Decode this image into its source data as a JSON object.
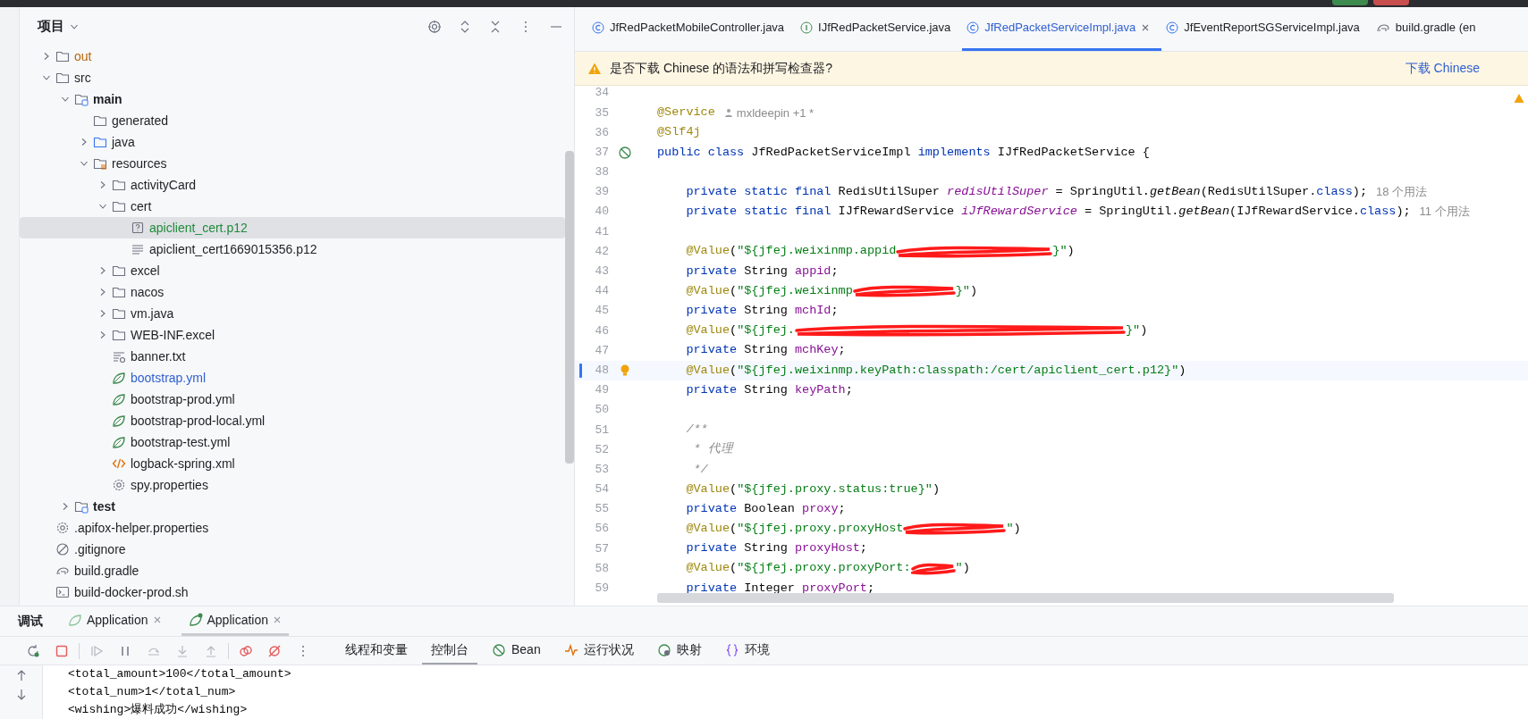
{
  "project_panel": {
    "title": "项目",
    "tree": [
      {
        "name": "out",
        "kind": "folder",
        "color": "#b8650b",
        "expanded": false,
        "selected": false
      },
      {
        "name": "src",
        "kind": "folder",
        "expanded": true,
        "selected": false,
        "children": [
          {
            "name": "main",
            "kind": "module",
            "expanded": true,
            "selected": false,
            "children": [
              {
                "name": "generated",
                "kind": "folder",
                "selected": false
              },
              {
                "name": "java",
                "kind": "source",
                "expanded": false,
                "selected": false
              },
              {
                "name": "resources",
                "kind": "resources",
                "expanded": true,
                "selected": false,
                "children": [
                  {
                    "name": "activityCard",
                    "kind": "folder",
                    "expanded": false,
                    "selected": false
                  },
                  {
                    "name": "cert",
                    "kind": "folder",
                    "expanded": true,
                    "selected": false,
                    "children": [
                      {
                        "name": "apiclient_cert.p12",
                        "kind": "unknown",
                        "color": "#1f8a3a",
                        "selected": true
                      },
                      {
                        "name": "apiclient_cert1669015356.p12",
                        "kind": "text",
                        "selected": false
                      }
                    ]
                  },
                  {
                    "name": "excel",
                    "kind": "folder",
                    "expanded": false,
                    "selected": false
                  },
                  {
                    "name": "nacos",
                    "kind": "folder",
                    "expanded": false,
                    "selected": false
                  },
                  {
                    "name": "vm.java",
                    "kind": "folder",
                    "expanded": false,
                    "selected": false
                  },
                  {
                    "name": "WEB-INF.excel",
                    "kind": "folder",
                    "expanded": false,
                    "selected": false
                  },
                  {
                    "name": "banner.txt",
                    "kind": "textlock",
                    "selected": false
                  },
                  {
                    "name": "bootstrap.yml",
                    "kind": "spring",
                    "color": "#2f5fd0",
                    "selected": false
                  },
                  {
                    "name": "bootstrap-prod.yml",
                    "kind": "spring",
                    "selected": false
                  },
                  {
                    "name": "bootstrap-prod-local.yml",
                    "kind": "spring",
                    "selected": false
                  },
                  {
                    "name": "bootstrap-test.yml",
                    "kind": "spring",
                    "selected": false
                  },
                  {
                    "name": "logback-spring.xml",
                    "kind": "xml",
                    "selected": false
                  },
                  {
                    "name": "spy.properties",
                    "kind": "gear",
                    "selected": false
                  }
                ]
              }
            ]
          },
          {
            "name": "test",
            "kind": "module",
            "expanded": false,
            "selected": false
          }
        ]
      },
      {
        "name": ".apifox-helper.properties",
        "kind": "gear",
        "selected": false
      },
      {
        "name": ".gitignore",
        "kind": "ignore",
        "selected": false
      },
      {
        "name": "build.gradle",
        "kind": "gradle",
        "selected": false
      },
      {
        "name": "build-docker-prod.sh",
        "kind": "shell",
        "selected": false
      }
    ]
  },
  "editor": {
    "tabs": [
      {
        "label": "JfRedPacketMobileController.java",
        "kind": "class",
        "selected": false
      },
      {
        "label": "IJfRedPacketService.java",
        "kind": "interface",
        "selected": false
      },
      {
        "label": "JfRedPacketServiceImpl.java",
        "kind": "class",
        "selected": true
      },
      {
        "label": "JfEventReportSGServiceImpl.java",
        "kind": "class",
        "selected": false
      },
      {
        "label": "build.gradle (en",
        "kind": "gradle",
        "selected": false
      }
    ],
    "notification": {
      "message": "是否下载 Chinese 的语法和拼写检查器?",
      "action": "下载 Chinese"
    },
    "lines": [
      {
        "number": "34",
        "kind": "plain",
        "current": false
      },
      {
        "number": "35",
        "kind": "plain",
        "current": false,
        "tokens": [
          {
            "kind": "annotation",
            "text": "@Service"
          }
        ],
        "hint": {
          "kind": "author",
          "text": "mxldeepin +1 *"
        }
      },
      {
        "number": "36",
        "kind": "plain",
        "current": false,
        "tokens": [
          {
            "kind": "annotation",
            "text": "@Slf4j"
          }
        ]
      },
      {
        "number": "37",
        "kind": "bean",
        "current": false,
        "tokens": [
          {
            "kind": "keyword",
            "text": "public class "
          },
          {
            "kind": "plain",
            "text": "JfRedPacketServiceImpl "
          },
          {
            "kind": "keyword",
            "text": "implements "
          },
          {
            "kind": "plain",
            "text": "IJfRedPacketService {"
          }
        ]
      },
      {
        "number": "38",
        "kind": "plain",
        "current": false
      },
      {
        "number": "39",
        "kind": "plain",
        "current": false,
        "tokens": [
          {
            "kind": "keyword",
            "text": "    private static final "
          },
          {
            "kind": "plain",
            "text": "RedisUtilSuper "
          },
          {
            "kind": "static",
            "text": "redisUtilSuper"
          },
          {
            "kind": "plain",
            "text": " = SpringUtil."
          },
          {
            "kind": "method",
            "text": "getBean"
          },
          {
            "kind": "plain",
            "text": "(RedisUtilSuper."
          },
          {
            "kind": "keyword",
            "text": "class"
          },
          {
            "kind": "plain",
            "text": ");"
          }
        ],
        "hint": {
          "kind": "usages",
          "text": "18 个用法"
        }
      },
      {
        "number": "40",
        "kind": "plain",
        "current": false,
        "tokens": [
          {
            "kind": "keyword",
            "text": "    private static final "
          },
          {
            "kind": "plain",
            "text": "IJfRewardService "
          },
          {
            "kind": "static",
            "text": "iJfRewardService"
          },
          {
            "kind": "plain",
            "text": " = SpringUtil."
          },
          {
            "kind": "method",
            "text": "getBean"
          },
          {
            "kind": "plain",
            "text": "(IJfRewardService."
          },
          {
            "kind": "keyword",
            "text": "class"
          },
          {
            "kind": "plain",
            "text": ");"
          }
        ],
        "hint": {
          "kind": "usages",
          "text": "11 个用法"
        }
      },
      {
        "number": "41",
        "kind": "plain",
        "current": false
      },
      {
        "number": "42",
        "kind": "plain",
        "current": false,
        "tokens": [
          {
            "kind": "annotation",
            "text": "    @Value"
          },
          {
            "kind": "plain",
            "text": "("
          },
          {
            "kind": "string",
            "text": "\"${jfej.weixinmp.appid"
          },
          {
            "kind": "redacted-long"
          },
          {
            "kind": "string",
            "text": "}\""
          },
          {
            "kind": "plain",
            "text": ")"
          }
        ]
      },
      {
        "number": "43",
        "kind": "plain",
        "current": false,
        "tokens": [
          {
            "kind": "keyword",
            "text": "    private "
          },
          {
            "kind": "plain",
            "text": "String "
          },
          {
            "kind": "field",
            "text": "appid"
          },
          {
            "kind": "plain",
            "text": ";"
          }
        ]
      },
      {
        "number": "44",
        "kind": "plain",
        "current": false,
        "tokens": [
          {
            "kind": "annotation",
            "text": "    @Value"
          },
          {
            "kind": "plain",
            "text": "("
          },
          {
            "kind": "string",
            "text": "\"${jfej.weixinmp"
          },
          {
            "kind": "redacted-medium"
          },
          {
            "kind": "string",
            "text": "}\""
          },
          {
            "kind": "plain",
            "text": ")"
          }
        ]
      },
      {
        "number": "45",
        "kind": "plain",
        "current": false,
        "tokens": [
          {
            "kind": "keyword",
            "text": "    private "
          },
          {
            "kind": "plain",
            "text": "String "
          },
          {
            "kind": "field",
            "text": "mchId"
          },
          {
            "kind": "plain",
            "text": ";"
          }
        ]
      },
      {
        "number": "46",
        "kind": "plain",
        "current": false,
        "tokens": [
          {
            "kind": "annotation",
            "text": "    @Value"
          },
          {
            "kind": "plain",
            "text": "("
          },
          {
            "kind": "string",
            "text": "\"${jfej."
          },
          {
            "kind": "redacted-xlong"
          },
          {
            "kind": "string",
            "text": "}\""
          },
          {
            "kind": "plain",
            "text": ")"
          }
        ]
      },
      {
        "number": "47",
        "kind": "plain",
        "current": false,
        "tokens": [
          {
            "kind": "keyword",
            "text": "    private "
          },
          {
            "kind": "plain",
            "text": "String "
          },
          {
            "kind": "field",
            "text": "mchKey"
          },
          {
            "kind": "plain",
            "text": ";"
          }
        ]
      },
      {
        "number": "48",
        "kind": "bulb",
        "current": true,
        "tokens": [
          {
            "kind": "annotation",
            "text": "    @Value"
          },
          {
            "kind": "plain",
            "text": "("
          },
          {
            "kind": "string",
            "text": "\"${jfej.weixinmp.keyPath:classpath:/cert/apiclient_cert.p12}\""
          },
          {
            "kind": "plain",
            "text": ")"
          }
        ]
      },
      {
        "number": "49",
        "kind": "plain",
        "current": false,
        "tokens": [
          {
            "kind": "keyword",
            "text": "    private "
          },
          {
            "kind": "plain",
            "text": "String "
          },
          {
            "kind": "field",
            "text": "keyPath"
          },
          {
            "kind": "plain",
            "text": ";"
          }
        ]
      },
      {
        "number": "50",
        "kind": "plain",
        "current": false
      },
      {
        "number": "51",
        "kind": "plain",
        "current": false,
        "tokens": [
          {
            "kind": "comment",
            "text": "    /**"
          }
        ]
      },
      {
        "number": "52",
        "kind": "plain",
        "current": false,
        "tokens": [
          {
            "kind": "comment",
            "text": "     * 代理"
          }
        ]
      },
      {
        "number": "53",
        "kind": "plain",
        "current": false,
        "tokens": [
          {
            "kind": "comment",
            "text": "     */"
          }
        ]
      },
      {
        "number": "54",
        "kind": "plain",
        "current": false,
        "tokens": [
          {
            "kind": "annotation",
            "text": "    @Value"
          },
          {
            "kind": "plain",
            "text": "("
          },
          {
            "kind": "string",
            "text": "\"${jfej.proxy.status:true}\""
          },
          {
            "kind": "plain",
            "text": ")"
          }
        ]
      },
      {
        "number": "55",
        "kind": "plain",
        "current": false,
        "tokens": [
          {
            "kind": "keyword",
            "text": "    private "
          },
          {
            "kind": "plain",
            "text": "Boolean "
          },
          {
            "kind": "field",
            "text": "proxy"
          },
          {
            "kind": "plain",
            "text": ";"
          }
        ]
      },
      {
        "number": "56",
        "kind": "plain",
        "current": false,
        "tokens": [
          {
            "kind": "annotation",
            "text": "    @Value"
          },
          {
            "kind": "plain",
            "text": "("
          },
          {
            "kind": "string",
            "text": "\"${jfej.proxy.proxyHost"
          },
          {
            "kind": "redacted-medium"
          },
          {
            "kind": "string",
            "text": "\""
          },
          {
            "kind": "plain",
            "text": ")"
          }
        ]
      },
      {
        "number": "57",
        "kind": "plain",
        "current": false,
        "tokens": [
          {
            "kind": "keyword",
            "text": "    private "
          },
          {
            "kind": "plain",
            "text": "String "
          },
          {
            "kind": "field",
            "text": "proxyHost"
          },
          {
            "kind": "plain",
            "text": ";"
          }
        ]
      },
      {
        "number": "58",
        "kind": "plain",
        "current": false,
        "tokens": [
          {
            "kind": "annotation",
            "text": "    @Value"
          },
          {
            "kind": "plain",
            "text": "("
          },
          {
            "kind": "string",
            "text": "\"${jfej.proxy.proxyPort:"
          },
          {
            "kind": "redacted-short"
          },
          {
            "kind": "string",
            "text": "\""
          },
          {
            "kind": "plain",
            "text": ")"
          }
        ]
      },
      {
        "number": "59",
        "kind": "plain",
        "current": false,
        "tokens": [
          {
            "kind": "keyword",
            "text": "    private "
          },
          {
            "kind": "plain",
            "text": "Integer "
          },
          {
            "kind": "field",
            "text": "proxyPort"
          },
          {
            "kind": "plain",
            "text": ";"
          }
        ]
      }
    ]
  },
  "debug_panel": {
    "title": "调试",
    "sessions": [
      {
        "label": "Application",
        "running": false,
        "selected": false
      },
      {
        "label": "Application",
        "running": true,
        "selected": true
      }
    ],
    "tabs": [
      {
        "label": "线程和变量",
        "kind": "threads",
        "selected": false
      },
      {
        "label": "控制台",
        "kind": "console",
        "selected": true
      },
      {
        "label": "Bean",
        "kind": "bean",
        "selected": false
      },
      {
        "label": "运行状况",
        "kind": "health",
        "selected": false
      },
      {
        "label": "映射",
        "kind": "mapping",
        "selected": false
      },
      {
        "label": "环境",
        "kind": "environment",
        "selected": false
      }
    ],
    "console": [
      "<total_amount>100</total_amount>",
      "<total_num>1</total_num>",
      "<wishing>爆料成功</wishing>"
    ]
  }
}
